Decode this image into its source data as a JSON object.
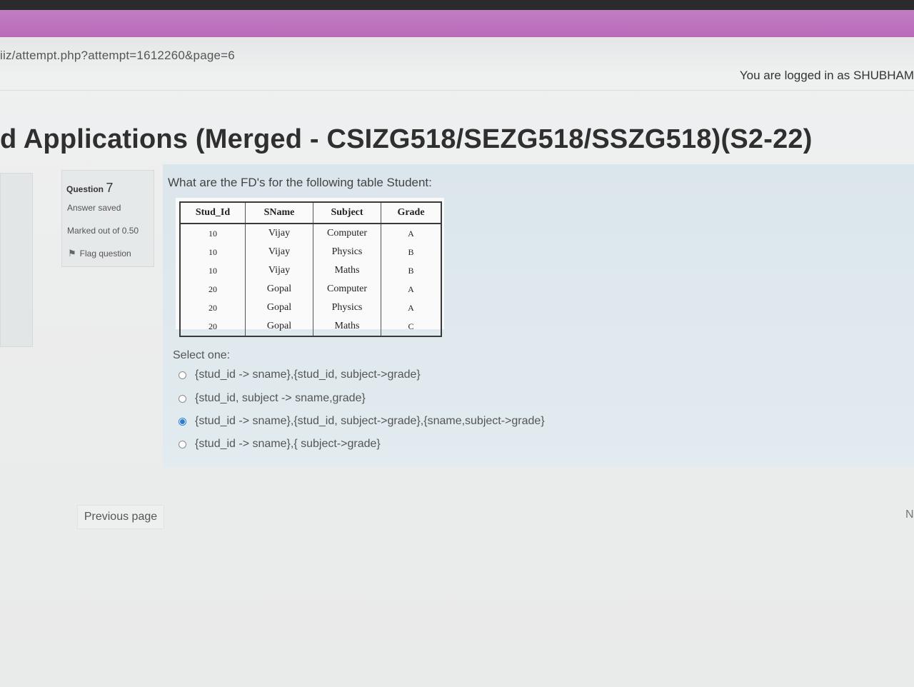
{
  "browser": {
    "url": "iiz/attempt.php?attempt=1612260&page=6"
  },
  "header": {
    "logged_in": "You are logged in as SHUBHAM"
  },
  "course": {
    "title": "d Applications (Merged - CSIZG518/SEZG518/SSZG518)(S2-22)"
  },
  "question_info": {
    "label": "Question",
    "number": "7",
    "status": "Answer saved",
    "marked": "Marked out of 0.50",
    "flag_label": "Flag question"
  },
  "question": {
    "text": "What are the FD's for the following table Student:",
    "table": {
      "headers": [
        "Stud_Id",
        "SName",
        "Subject",
        "Grade"
      ],
      "rows": [
        [
          "10",
          "Vijay",
          "Computer",
          "A"
        ],
        [
          "10",
          "Vijay",
          "Physics",
          "B"
        ],
        [
          "10",
          "Vijay",
          "Maths",
          "B"
        ],
        [
          "20",
          "Gopal",
          "Computer",
          "A"
        ],
        [
          "20",
          "Gopal",
          "Physics",
          "A"
        ],
        [
          "20",
          "Gopal",
          "Maths",
          "C"
        ]
      ]
    },
    "select_label": "Select one:",
    "options": [
      {
        "label": "{stud_id -> sname},{stud_id, subject->grade}",
        "selected": false
      },
      {
        "label": "{stud_id, subject -> sname,grade}",
        "selected": false
      },
      {
        "label": "{stud_id -> sname},{stud_id, subject->grade},{sname,subject->grade}",
        "selected": true
      },
      {
        "label": "{stud_id -> sname},{ subject->grade}",
        "selected": false
      }
    ]
  },
  "nav": {
    "previous": "Previous page",
    "next": "N"
  },
  "colors": {
    "accent": "#2a7cd1",
    "bar": "#b86ab9"
  }
}
